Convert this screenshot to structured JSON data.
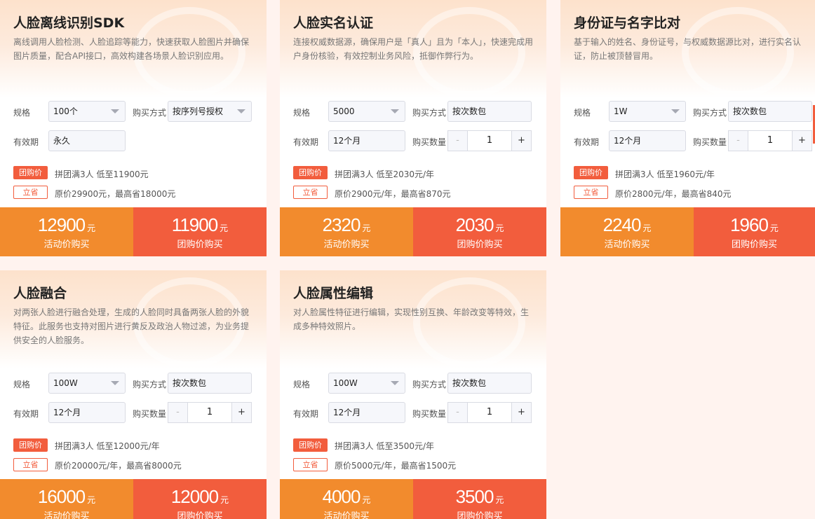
{
  "labels": {
    "spec": "规格",
    "purchase_mode": "购买方式",
    "validity": "有效期",
    "quantity": "购买数量",
    "group_tag": "团购价",
    "save_tag": "立省",
    "unit": "元",
    "activity_btn": "活动价购买",
    "group_btn": "团购价购买",
    "minus": "-",
    "plus": "+"
  },
  "colors": {
    "activity_orange": "#f28b2d",
    "group_red": "#f25d3d"
  },
  "cards": [
    {
      "title": "人脸离线识别SDK",
      "desc": "离线调用人脸检测、人脸追踪等能力，快速获取人脸图片并确保图片质量，配合API接口，高效构建各场景人脸识别应用。",
      "spec": "100个",
      "purchase_mode": "按序列号授权",
      "validity": "永久",
      "quantity": "",
      "group_info": "拼团满3人 低至11900元",
      "save_info": "原价29900元，最高省18000元",
      "activity_price": "12900",
      "group_price": "11900"
    },
    {
      "title": "人脸实名认证",
      "desc": "连接权威数据源，确保用户是「真人」且为「本人」，快速完成用户身份核验，有效控制业务风险，抵御作弊行为。",
      "spec": "5000",
      "purchase_mode": "按次数包",
      "validity": "12个月",
      "quantity": "1",
      "group_info": "拼团满3人 低至2030元/年",
      "save_info": "原价2900元/年，最高省870元",
      "activity_price": "2320",
      "group_price": "2030"
    },
    {
      "title": "身份证与名字比对",
      "desc": "基于输入的姓名、身份证号，与权威数据源比对，进行实名认证，防止被顶替冒用。",
      "spec": "1W",
      "purchase_mode": "按次数包",
      "validity": "12个月",
      "quantity": "1",
      "group_info": "拼团满3人 低至1960元/年",
      "save_info": "原价2800元/年，最高省840元",
      "activity_price": "2240",
      "group_price": "1960"
    },
    {
      "title": "人脸融合",
      "desc": "对两张人脸进行融合处理，生成的人脸同时具备两张人脸的外貌特征。此服务也支持对图片进行黄反及政治人物过滤，为业务提供安全的人脸服务。",
      "spec": "100W",
      "purchase_mode": "按次数包",
      "validity": "12个月",
      "quantity": "1",
      "group_info": "拼团满3人 低至12000元/年",
      "save_info": "原价20000元/年，最高省8000元",
      "activity_price": "16000",
      "group_price": "12000"
    },
    {
      "title": "人脸属性编辑",
      "desc": "对人脸属性特征进行编辑，实现性别互换、年龄改变等特效，生成多种特效照片。",
      "spec": "100W",
      "purchase_mode": "按次数包",
      "validity": "12个月",
      "quantity": "1",
      "group_info": "拼团满3人 低至3500元/年",
      "save_info": "原价5000元/年，最高省1500元",
      "activity_price": "4000",
      "group_price": "3500"
    }
  ]
}
